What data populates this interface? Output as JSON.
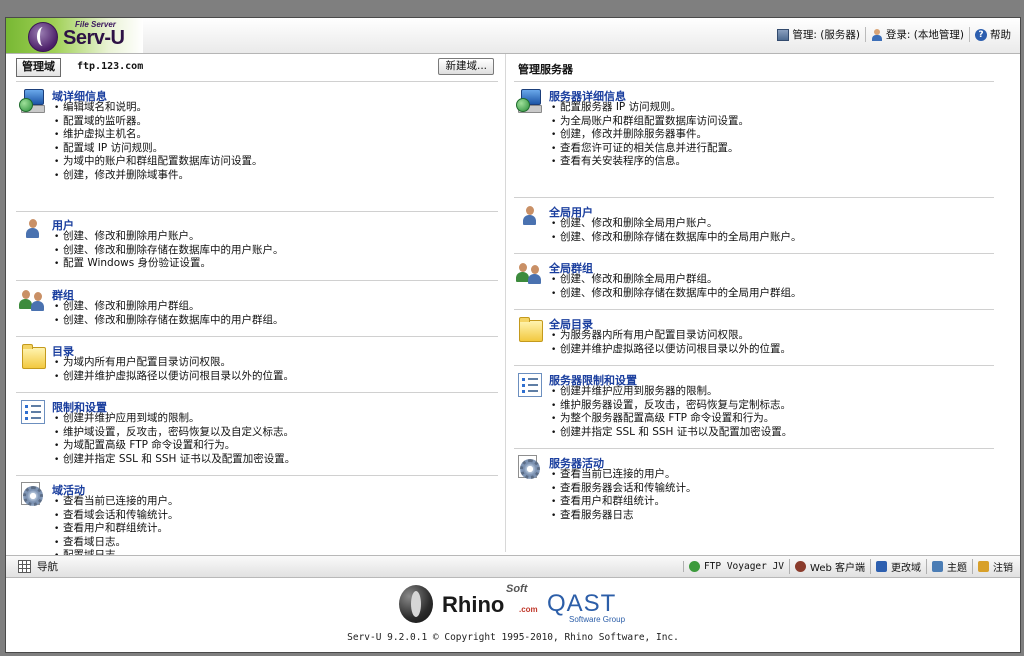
{
  "header": {
    "logo_small": "File Server",
    "logo_main": "Serv-U",
    "links": [
      {
        "label": "管理: (服务器)",
        "icon": "server-icon"
      },
      {
        "label": "登录: (本地管理)",
        "icon": "user-icon"
      },
      {
        "label": "帮助",
        "icon": "help-icon"
      }
    ]
  },
  "left": {
    "tab_label": "管理域",
    "domain_name": "ftp.123.com",
    "new_domain_label": "新建域...",
    "sections": [
      {
        "title": "域详细信息",
        "icon": "domain-details-icon",
        "items": [
          "编辑域名和说明。",
          "配置域的监听器。",
          "维护虚拟主机名。",
          "配置域 IP 访问规则。",
          "为域中的账户和群组配置数据库访问设置。",
          "创建，修改并删除域事件。"
        ]
      },
      {
        "title": "用户",
        "icon": "user-icon",
        "items": [
          "创建、修改和删除用户账户。",
          "创建、修改和删除存储在数据库中的用户账户。",
          "配置 Windows 身份验证设置。"
        ]
      },
      {
        "title": "群组",
        "icon": "group-icon",
        "items": [
          "创建、修改和删除用户群组。",
          "创建、修改和删除存储在数据库中的用户群组。"
        ]
      },
      {
        "title": "目录",
        "icon": "folder-icon",
        "items": [
          "为域内所有用户配置目录访问权限。",
          "创建并维护虚拟路径以便访问根目录以外的位置。"
        ]
      },
      {
        "title": "限制和设置",
        "icon": "limits-list-icon",
        "items": [
          "创建并维护应用到域的限制。",
          "维护域设置，反攻击，密码恢复以及自定义标志。",
          "为域配置高级 FTP 命令设置和行为。",
          "创建并指定 SSL 和 SSH 证书以及配置加密设置。"
        ]
      },
      {
        "title": "域活动",
        "icon": "activity-gear-icon",
        "items": [
          "查看当前已连接的用户。",
          "查看域会话和传输统计。",
          "查看用户和群组统计。",
          "查看域日志。",
          "配置域日志。"
        ]
      }
    ]
  },
  "right": {
    "title": "管理服务器",
    "sections": [
      {
        "title": "服务器详细信息",
        "icon": "server-details-icon",
        "items": [
          "配置服务器 IP 访问规则。",
          "为全局账户和群组配置数据库访问设置。",
          "创建，修改并删除服务器事件。",
          "查看您许可证的相关信息并进行配置。",
          "查看有关安装程序的信息。"
        ]
      },
      {
        "title": "全局用户",
        "icon": "global-user-icon",
        "items": [
          "创建、修改和删除全局用户账户。",
          "创建、修改和删除存储在数据库中的全局用户账户。"
        ]
      },
      {
        "title": "全局群组",
        "icon": "global-group-icon",
        "items": [
          "创建、修改和删除全局用户群组。",
          "创建、修改和删除存储在数据库中的全局用户群组。"
        ]
      },
      {
        "title": "全局目录",
        "icon": "global-folder-icon",
        "items": [
          "为服务器内所有用户配置目录访问权限。",
          "创建并维护虚拟路径以便访问根目录以外的位置。"
        ]
      },
      {
        "title": "服务器限制和设置",
        "icon": "server-limits-list-icon",
        "items": [
          "创建并维护应用到服务器的限制。",
          "维护服务器设置，反攻击，密码恢复与定制标志。",
          "为整个服务器配置高级 FTP 命令设置和行为。",
          "创建并指定 SSL 和 SSH 证书以及配置加密设置。"
        ]
      },
      {
        "title": "服务器活动",
        "icon": "server-activity-gear-icon",
        "items": [
          "查看当前已连接的用户。",
          "查看服务器会话和传输统计。",
          "查看用户和群组统计。",
          "查看服务器日志"
        ]
      }
    ]
  },
  "toolbar": {
    "nav_label": "导航",
    "buttons": [
      {
        "label": "FTP Voyager JV",
        "icon": "ftp-voyager-icon",
        "color": "#3c9a3c"
      },
      {
        "label": "Web 客户端",
        "icon": "web-client-icon",
        "color": "#8a3b2c"
      },
      {
        "label": "更改域",
        "icon": "change-domain-icon",
        "color": "#2d5faf"
      },
      {
        "label": "主题",
        "icon": "theme-icon",
        "color": "#4b7db5"
      },
      {
        "label": "注销",
        "icon": "logout-icon",
        "color": "#d8a02a"
      }
    ]
  },
  "footer": {
    "rhino_text": "Rhino",
    "rhino_soft": "Soft",
    "rhino_com": ".com",
    "qast_text": "QAST",
    "qast_sub": "Software Group",
    "copyright": "Serv-U 9.2.0.1 © Copyright 1995-2010, Rhino Software, Inc."
  },
  "colors": {
    "accent_title": "#1a3e9e",
    "logo_green": "#78b834",
    "logo_purple": "#4c1f69"
  }
}
